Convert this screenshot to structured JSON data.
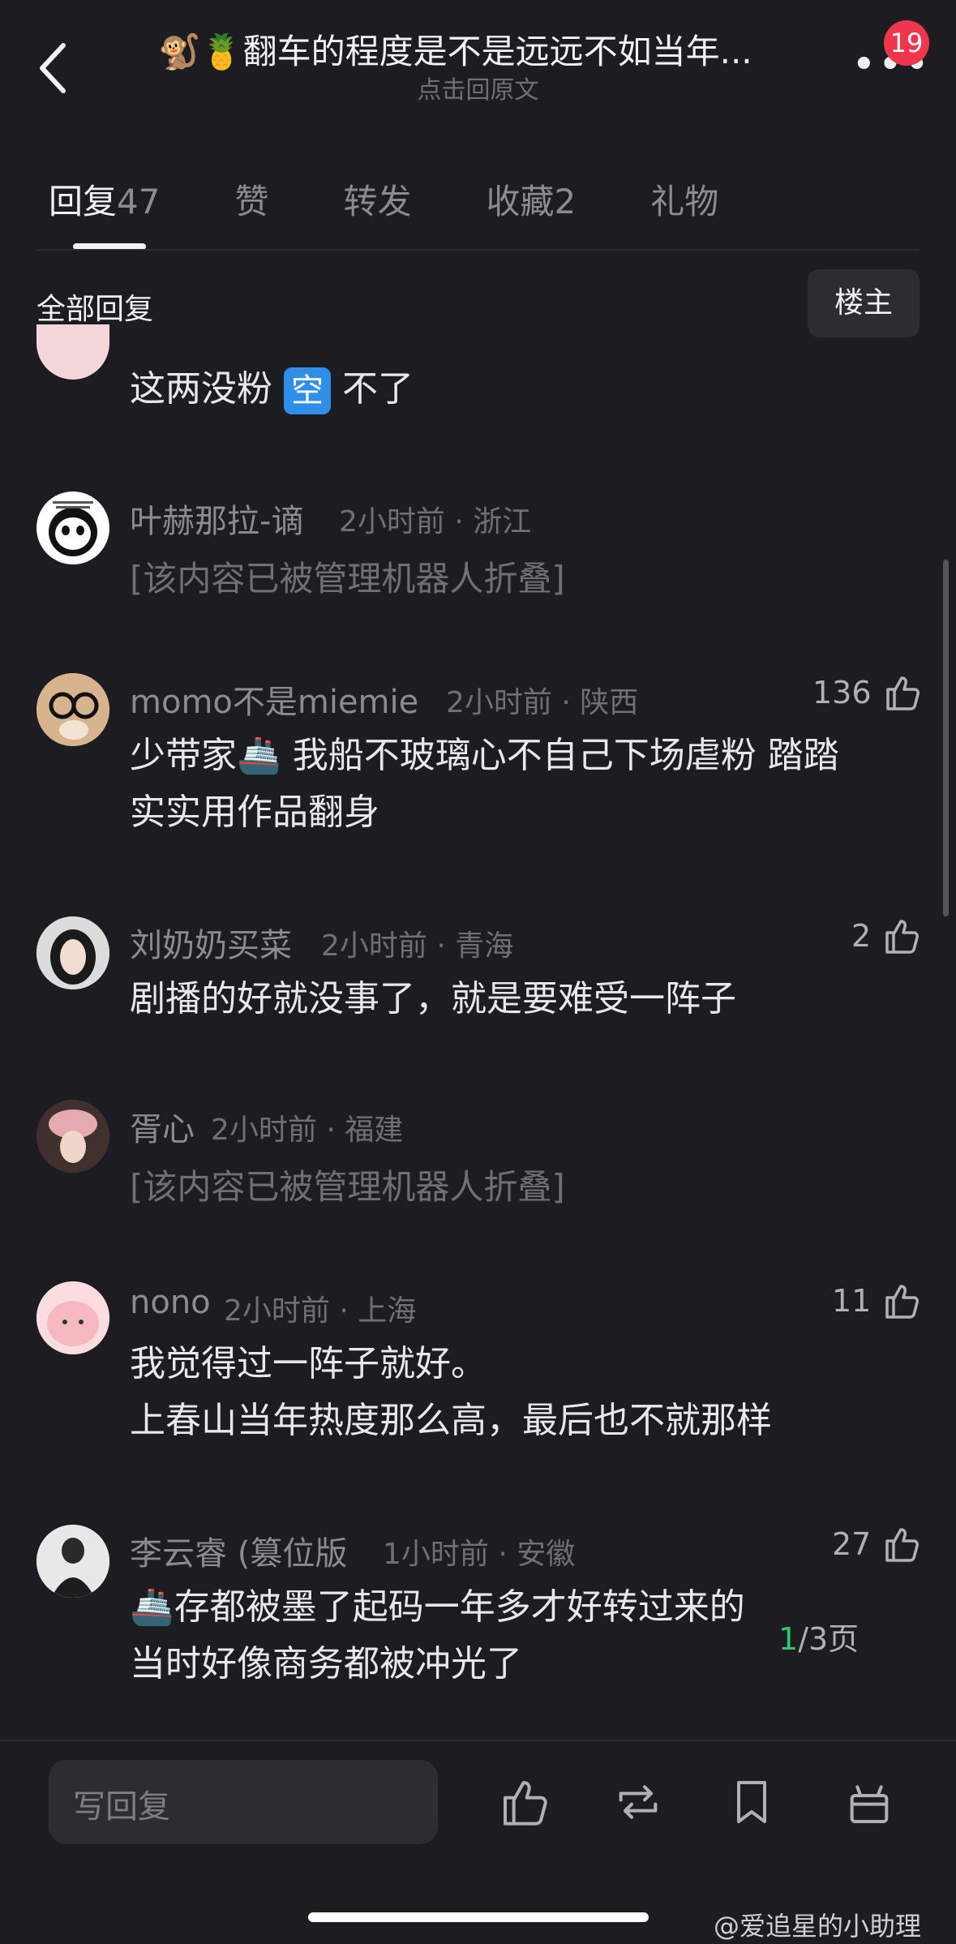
{
  "header": {
    "title": "🐒🍍翻车的程度是不是远远不如当年...",
    "subtitle": "点击回原文",
    "notification_count": "19"
  },
  "tabs": [
    {
      "label": "回复",
      "count": "47"
    },
    {
      "label": "赞",
      "count": ""
    },
    {
      "label": "转发",
      "count": ""
    },
    {
      "label": "收藏",
      "count": "2"
    },
    {
      "label": "礼物",
      "count": ""
    }
  ],
  "section": {
    "title": "全部回复",
    "owner_button": "楼主"
  },
  "partial_comment": {
    "text_before": "这两没粉",
    "emoji": "空",
    "text_after": "不了"
  },
  "comments": [
    {
      "name": "叶赫那拉-谪",
      "meta": "2小时前 · 浙江",
      "likes": "",
      "lines": [
        "[该内容已被管理机器人折叠]"
      ],
      "folded": true
    },
    {
      "name": "momo不是miemie",
      "meta": "2小时前 · 陕西",
      "likes": "136",
      "lines": [
        "少带家🚢 我船不玻璃心不自己下场虐粉 踏踏",
        "实实用作品翻身"
      ]
    },
    {
      "name": "刘奶奶买菜",
      "meta": "2小时前 · 青海",
      "likes": "2",
      "lines": [
        "剧播的好就没事了，就是要难受一阵子"
      ]
    },
    {
      "name": "胥心",
      "meta": "2小时前 · 福建",
      "likes": "",
      "lines": [
        "[该内容已被管理机器人折叠]"
      ],
      "folded": true
    },
    {
      "name": "nono",
      "meta": "2小时前 · 上海",
      "likes": "11",
      "lines": [
        "我觉得过一阵子就好。",
        "上春山当年热度那么高，最后也不就那样"
      ]
    },
    {
      "name": "李云睿 (篡位版",
      "meta": "1小时前 · 安徽",
      "likes": "27",
      "lines": [
        "🚢存都被墨了起码一年多才好转过来的",
        "当时好像商务都被冲光了"
      ]
    }
  ],
  "pager": {
    "current": "1",
    "total": "/3页"
  },
  "bottom_bar": {
    "reply_placeholder": "写回复"
  },
  "watermark": "@爱追星的小助理",
  "colors": {
    "background": "#1c1c21",
    "badge": "#f0364d",
    "pager_current": "#2fc76c",
    "emoji_box": "#2f8fe8"
  }
}
